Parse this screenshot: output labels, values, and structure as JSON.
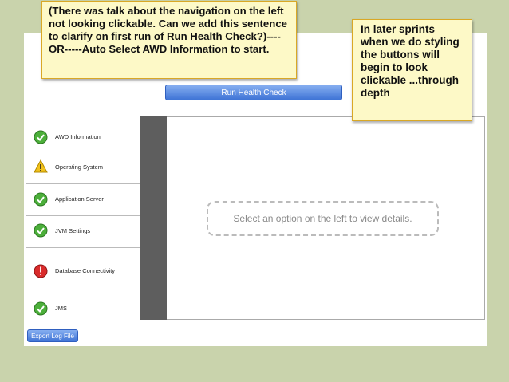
{
  "toolbar": {
    "run_label": "Run Health Check"
  },
  "nav": {
    "items": [
      {
        "label": "AWD Information",
        "status": "ok"
      },
      {
        "label": "Operating System",
        "status": "warning"
      },
      {
        "label": "Application Server",
        "status": "ok"
      },
      {
        "label": "JVM Settings",
        "status": "ok"
      },
      {
        "label": "Database Connectivity",
        "status": "error"
      },
      {
        "label": "JMS",
        "status": "ok"
      }
    ]
  },
  "detail": {
    "placeholder": "Select an option on the left to view details."
  },
  "footer": {
    "export_label": "Export Log File"
  },
  "notes": {
    "left": "(There was talk about the navigation on the left not looking clickable. Can we add this sentence to clarify on first run of Run Health Check?)----OR-----Auto Select AWD Information to start.",
    "right": "In later sprints when we do styling the buttons will begin to look clickable ...through depth"
  },
  "colors": {
    "background": "#c9d3ac",
    "ok": "#4caf3a",
    "warning": "#f2c21b",
    "error": "#d92b2b",
    "button": "#4a7fdc"
  }
}
